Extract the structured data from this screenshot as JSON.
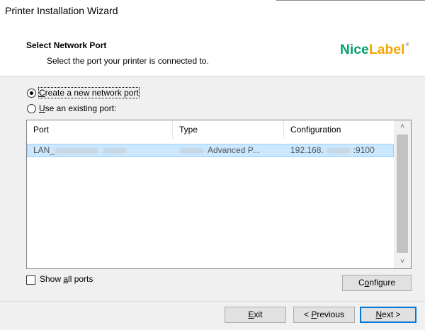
{
  "window": {
    "title": "Printer Installation Wizard"
  },
  "header": {
    "title": "Select Network Port",
    "subtitle": "Select the port your printer is connected to.",
    "logo": {
      "part1": "Nice",
      "part2": "Label",
      "mark": "®"
    },
    "colors": {
      "logo_green": "#00a26b",
      "logo_orange": "#f6a400"
    }
  },
  "options": {
    "new_port": {
      "prefix": "",
      "accel": "C",
      "rest": "reate a new network port",
      "checked": true
    },
    "existing_port": {
      "prefix": "",
      "accel": "U",
      "rest": "se an existing port:",
      "checked": false
    }
  },
  "ports_table": {
    "columns": [
      "Port",
      "Type",
      "Configuration"
    ],
    "rows": [
      {
        "port_prefix": "LAN_",
        "type_suffix": "Advanced P...",
        "config_prefix": "192.168.",
        "config_suffix": ":9100",
        "selected": true
      }
    ],
    "scroll_up_icon": "chevron-up-icon",
    "scroll_down_icon": "chevron-down-icon"
  },
  "show_all_ports": {
    "before": "Show ",
    "accel": "a",
    "after": "ll ports",
    "checked": false
  },
  "buttons": {
    "configure": {
      "before": "C",
      "accel": "o",
      "after": "nfigure"
    },
    "exit": {
      "before": "",
      "accel": "E",
      "after": "xit"
    },
    "previous": {
      "before": "< ",
      "accel": "P",
      "after": "revious"
    },
    "next": {
      "before": "",
      "accel": "N",
      "after": "ext >"
    }
  }
}
